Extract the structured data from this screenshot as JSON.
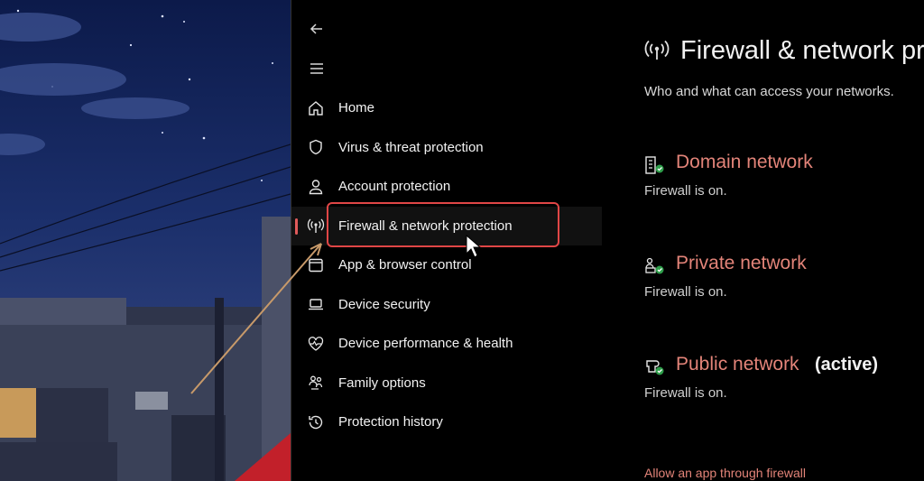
{
  "nav": {
    "back_icon": "back-arrow-icon",
    "menu_icon": "hamburger-menu-icon",
    "items": [
      {
        "label": "Home",
        "icon": "home-icon"
      },
      {
        "label": "Virus & threat protection",
        "icon": "shield-icon"
      },
      {
        "label": "Account protection",
        "icon": "person-icon"
      },
      {
        "label": "Firewall & network protection",
        "icon": "wireless-signal-icon",
        "selected": true
      },
      {
        "label": "App & browser control",
        "icon": "app-window-icon"
      },
      {
        "label": "Device security",
        "icon": "laptop-icon"
      },
      {
        "label": "Device performance & health",
        "icon": "heart-pulse-icon"
      },
      {
        "label": "Family options",
        "icon": "family-icon"
      },
      {
        "label": "Protection history",
        "icon": "history-icon"
      }
    ]
  },
  "main": {
    "title": "Firewall & network pr",
    "title_icon": "wireless-signal-icon",
    "subtitle": "Who and what can access your networks.",
    "networks": [
      {
        "name": "Domain network",
        "status": "Firewall is on.",
        "icon": "domain-building-icon",
        "active_label": ""
      },
      {
        "name": "Private network",
        "status": "Firewall is on.",
        "icon": "private-network-icon",
        "active_label": ""
      },
      {
        "name": "Public network",
        "status": "Firewall is on.",
        "icon": "public-network-icon",
        "active_label": "(active)"
      }
    ],
    "allow_app_link": "Allow an app through firewall"
  },
  "colors": {
    "accent": "#e38479",
    "highlight_border": "#e04646",
    "selection_bar": "#e05a5a",
    "annotation_arrow": "#c89a6a"
  }
}
